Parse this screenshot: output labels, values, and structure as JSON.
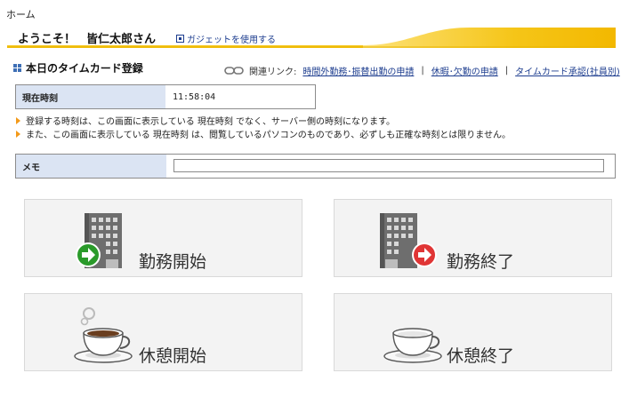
{
  "breadcrumb": {
    "home": "ホーム"
  },
  "header": {
    "welcome": "ようこそ！",
    "user_name": "皆仁太郎さん",
    "gadget_link": "ガジェットを使用する"
  },
  "section": {
    "title": "本日のタイムカード登録"
  },
  "related_links": {
    "label": "関連リンク:",
    "items": [
      {
        "label": "時間外勤務･振替出勤の申請"
      },
      {
        "label": "休暇･欠勤の申請"
      },
      {
        "label": "タイムカード承認(社員別)"
      }
    ],
    "separator": "|"
  },
  "current_time": {
    "label": "現在時刻",
    "value": "11:58:04"
  },
  "notes": [
    "登録する時刻は、この画面に表示している 現在時刻 でなく、サーバー側の時刻になります。",
    "また、この画面に表示している 現在時刻 は、閲覧しているパソコンのものであり、必ずしも正確な時刻とは限りません。"
  ],
  "memo": {
    "label": "メモ",
    "value": ""
  },
  "buttons": {
    "work_start": "勤務開始",
    "work_end": "勤務終了",
    "break_start": "休憩開始",
    "break_end": "休憩終了"
  },
  "colors": {
    "accent_yellow": "#f5c518",
    "label_bg": "#dbe4f3",
    "link": "#1d3d8f",
    "start_green": "#2a9a2a",
    "end_red": "#e03535",
    "note_arrow": "#f39a1a"
  }
}
